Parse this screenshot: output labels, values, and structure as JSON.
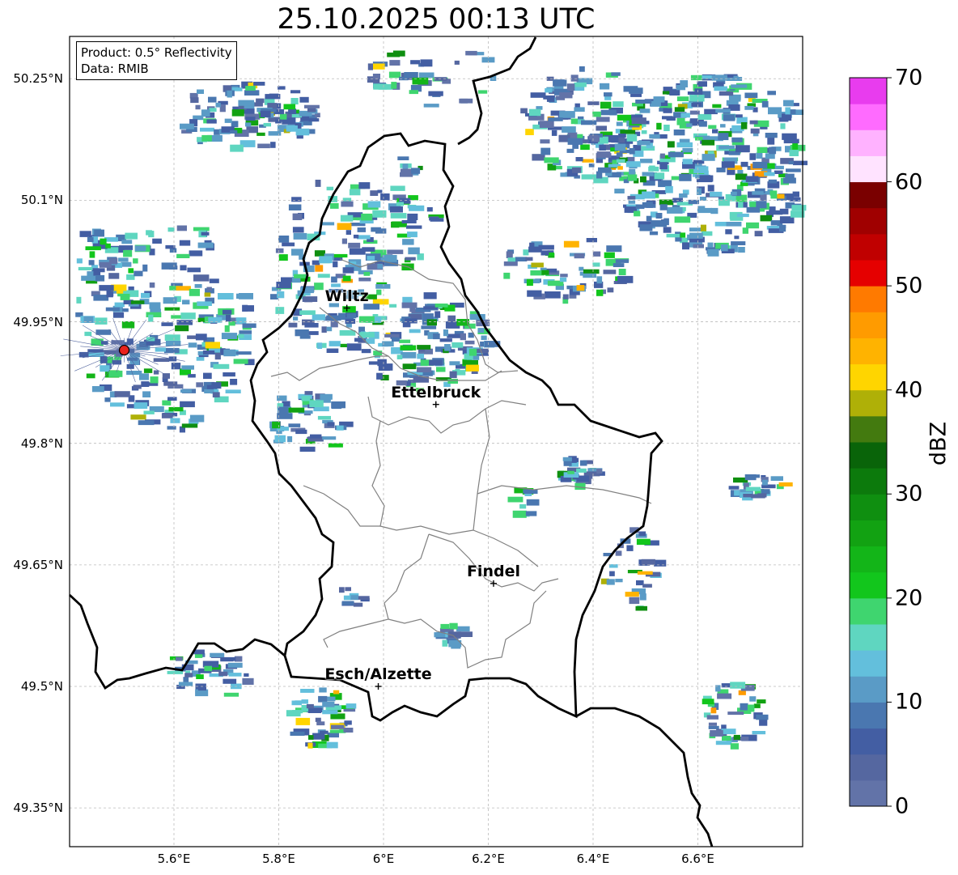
{
  "title": "25.10.2025 00:13 UTC",
  "info_box": {
    "product": "Product: 0.5° Reflectivity",
    "source": "Data: RMIB"
  },
  "lat_ticks": [
    "50.25°N",
    "50.1°N",
    "49.95°N",
    "49.8°N",
    "49.65°N",
    "49.5°N",
    "49.35°N"
  ],
  "lon_ticks": [
    "5.6°E",
    "5.8°E",
    "6°E",
    "6.2°E",
    "6.4°E",
    "6.6°E"
  ],
  "cities": [
    {
      "name": "Wiltz",
      "lat": 49.967,
      "lon": 5.93
    },
    {
      "name": "Ettelbruck",
      "lat": 49.848,
      "lon": 6.1
    },
    {
      "name": "Findel",
      "lat": 49.627,
      "lon": 6.21
    },
    {
      "name": "Esch/Alzette",
      "lat": 49.5,
      "lon": 5.99
    }
  ],
  "radar_site": {
    "lat": 49.915,
    "lon": 5.505,
    "color": "#e8221c"
  },
  "colorbar": {
    "unit": "dBZ",
    "min": 0,
    "max": 70,
    "tick_labels": [
      "0",
      "10",
      "20",
      "30",
      "40",
      "50",
      "60",
      "70"
    ],
    "colors": [
      "#6273a8",
      "#5567a0",
      "#435ea3",
      "#4a77b0",
      "#5a9bc6",
      "#63bfdc",
      "#5fd6c0",
      "#3fd56f",
      "#12c61c",
      "#13b518",
      "#12a212",
      "#0f8f10",
      "#0c7a0c",
      "#096409",
      "#437a0f",
      "#afb007",
      "#ffd500",
      "#ffb300",
      "#ff9b00",
      "#ff7a00",
      "#e50000",
      "#c00000",
      "#a00000",
      "#7a0000",
      "#ffe3ff",
      "#ffb2ff",
      "#ff6bff",
      "#e83cee"
    ]
  },
  "map_extent": {
    "lon_min": 5.4,
    "lon_max": 6.8,
    "lat_min": 49.3,
    "lat_max": 50.3
  },
  "colors": {
    "border": "#000000",
    "cantons": "#808080",
    "grid": "#bbbbbb"
  }
}
